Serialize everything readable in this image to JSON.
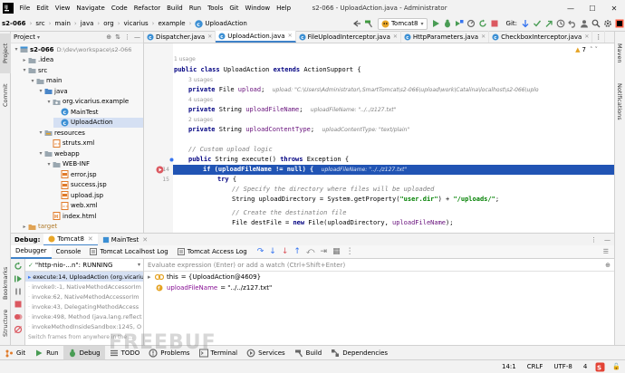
{
  "menubar": {
    "items": [
      "File",
      "Edit",
      "View",
      "Navigate",
      "Code",
      "Refactor",
      "Build",
      "Run",
      "Tools",
      "Git",
      "Window",
      "Help"
    ],
    "window_title": "s2-066 - UploadAction.java - Administrator"
  },
  "navbar": {
    "crumbs": [
      "s2-066",
      "src",
      "main",
      "java",
      "org",
      "vicarius",
      "example",
      "UploadAction"
    ],
    "run_config": "Tomcat8",
    "git_label": "Git:"
  },
  "project": {
    "header": "Project",
    "nodes": [
      {
        "label": "s2-066",
        "extra": "D:\\dev\\workspace\\s2-066",
        "level": 0,
        "arrow": "▾",
        "icon": "module"
      },
      {
        "label": ".idea",
        "level": 1,
        "arrow": "▸",
        "icon": "folder"
      },
      {
        "label": "src",
        "level": 1,
        "arrow": "▾",
        "icon": "folder"
      },
      {
        "label": "main",
        "level": 2,
        "arrow": "▾",
        "icon": "folder"
      },
      {
        "label": "java",
        "level": 3,
        "arrow": "▾",
        "icon": "srcfolder"
      },
      {
        "label": "org.vicarius.example",
        "level": 4,
        "arrow": "▾",
        "icon": "package"
      },
      {
        "label": "MainTest",
        "level": 5,
        "arrow": "",
        "icon": "class"
      },
      {
        "label": "UploadAction",
        "level": 5,
        "arrow": "",
        "icon": "class",
        "selected": true
      },
      {
        "label": "resources",
        "level": 3,
        "arrow": "▾",
        "icon": "resfolder"
      },
      {
        "label": "struts.xml",
        "level": 4,
        "arrow": "",
        "icon": "xml"
      },
      {
        "label": "webapp",
        "level": 3,
        "arrow": "▾",
        "icon": "folder"
      },
      {
        "label": "WEB-INF",
        "level": 4,
        "arrow": "▾",
        "icon": "folder"
      },
      {
        "label": "error.jsp",
        "level": 5,
        "arrow": "",
        "icon": "jsp"
      },
      {
        "label": "success.jsp",
        "level": 5,
        "arrow": "",
        "icon": "jsp"
      },
      {
        "label": "upload.jsp",
        "level": 5,
        "arrow": "",
        "icon": "jsp"
      },
      {
        "label": "web.xml",
        "level": 5,
        "arrow": "",
        "icon": "xml"
      },
      {
        "label": "index.html",
        "level": 4,
        "arrow": "",
        "icon": "html"
      },
      {
        "label": "target",
        "level": 1,
        "arrow": "▸",
        "icon": "target"
      }
    ]
  },
  "editor": {
    "tabs": [
      {
        "label": "Dispatcher.java",
        "active": false
      },
      {
        "label": "UploadAction.java",
        "active": true
      },
      {
        "label": "FileUploadInterceptor.java",
        "active": false
      },
      {
        "label": "HttpParameters.java",
        "active": false
      },
      {
        "label": "CheckboxInterceptor.java",
        "active": false
      }
    ],
    "warnings": "7",
    "hints": [
      "1 usage",
      "3 usages",
      "4 usages",
      "2 usages"
    ],
    "line_numbers": [
      "14",
      "15"
    ],
    "code": {
      "l1_kw": "public class ",
      "l1_name": "UploadAction ",
      "l1_kw2": "extends ",
      "l1_rest": "ActionSupport {",
      "l2_kw": "private ",
      "l2_type": "File ",
      "l2_fld": "upload",
      "l2_end": ";",
      "l2_ann": "upload: \"C:\\Users\\Administrator\\.SmartTomcat\\s2-066\\upload\\work\\Catalina\\localhost\\s2-066\\uplo",
      "l3_kw": "private ",
      "l3_type": "String ",
      "l3_fld": "uploadFileName",
      "l3_end": ";",
      "l3_ann": "uploadFileName: \"../../z127.txt\"",
      "l4_kw": "private ",
      "l4_type": "String ",
      "l4_fld": "uploadContentType",
      "l4_end": ";",
      "l4_ann": "uploadContentType: \"text/plain\"",
      "l5_cm": "// Custom upload logic",
      "l6_kw": "public ",
      "l6_type": "String ",
      "l6_name": "execute() ",
      "l6_kw2": "throws ",
      "l6_rest": "Exception {",
      "l7_code": "if (uploadFileName != null) {",
      "l7_ann": "uploadFileName: \"../../z127.txt\"",
      "l8_kw": "try ",
      "l8_rest": "{",
      "l9_cm": "// Specify the directory where files will be uploaded",
      "l10_a": "String uploadDirectory = System.getProperty(",
      "l10_s": "\"user.dir\"",
      "l10_b": ") + ",
      "l10_s2": "\"/uploads/\"",
      "l10_c": ";",
      "l11_cm": "// Create the destination file",
      "l12_a": "File destFile = ",
      "l12_kw": "new ",
      "l12_b": "File(uploadDirectory, ",
      "l12_fld": "uploadFileName",
      "l12_c": ");"
    }
  },
  "debug": {
    "title": "Debug:",
    "sessions": [
      "Tomcat8",
      "MainTest"
    ],
    "tabs": [
      "Debugger",
      "Console",
      "Tomcat Localhost Log",
      "Tomcat Access Log"
    ],
    "thread": "\"http-nio-...n\": RUNNING",
    "eval_placeholder": "Evaluate expression (Enter) or add a watch (Ctrl+Shift+Enter)",
    "frames": [
      {
        "label": "execute:14, UploadAction (org.vicarius",
        "selected": true
      },
      {
        "label": "invoke0:-1, NativeMethodAccessorIm",
        "selected": false
      },
      {
        "label": "invoke:62, NativeMethodAccessorIm",
        "selected": false
      },
      {
        "label": "invoke:43, DelegatingMethodAccess",
        "selected": false
      },
      {
        "label": "invoke:498, Method (java.lang.reflect",
        "selected": false
      },
      {
        "label": "invokeMethodInsideSandbox:1245, O",
        "selected": false
      }
    ],
    "frames_hint": "Switch frames from anywhere in the ...",
    "vars": [
      {
        "name": "this",
        "value": "= {UploadAction@4609}",
        "icon": "object",
        "expand": "▸"
      },
      {
        "name": "uploadFileName",
        "value": "= \"../../z127.txt\"",
        "icon": "field",
        "expand": " "
      }
    ]
  },
  "bottom_tools": [
    {
      "label": "Git",
      "icon": "git"
    },
    {
      "label": "Run",
      "icon": "run"
    },
    {
      "label": "Debug",
      "icon": "debug",
      "active": true
    },
    {
      "label": "TODO",
      "icon": "todo"
    },
    {
      "label": "Problems",
      "icon": "problems"
    },
    {
      "label": "Terminal",
      "icon": "terminal"
    },
    {
      "label": "Services",
      "icon": "services"
    },
    {
      "label": "Build",
      "icon": "build"
    },
    {
      "label": "Dependencies",
      "icon": "deps"
    }
  ],
  "status": {
    "position": "14:1",
    "line_sep": "CRLF",
    "encoding": "UTF-8",
    "indent": "4"
  },
  "sidebars": {
    "left": [
      "Project",
      "Commit",
      "Bookmarks",
      "Structure"
    ],
    "right": [
      "Maven",
      "Notifications"
    ]
  },
  "watermark": "FREEBUF",
  "colors": {
    "accent": "#4083c9",
    "exec_line": "#2154b4",
    "keyword": "#000080",
    "string": "#008000",
    "field": "#660e7a"
  }
}
